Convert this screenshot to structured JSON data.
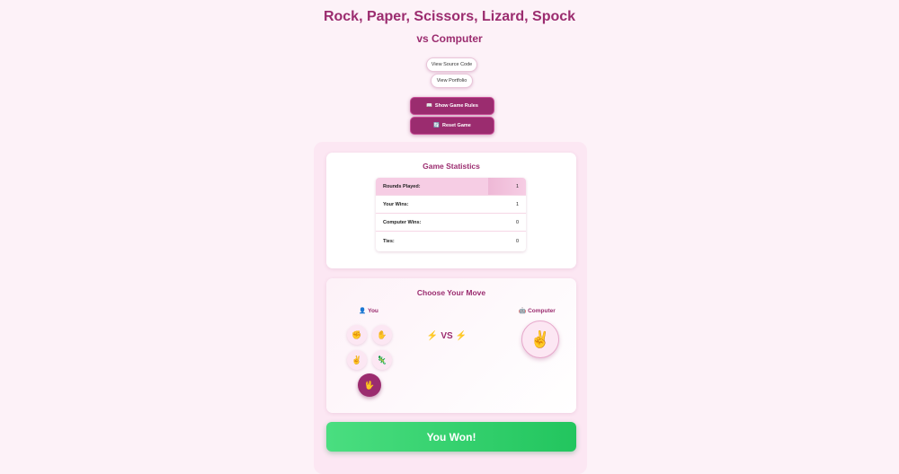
{
  "header": {
    "title": "Rock, Paper, Scissors, Lizard, Spock",
    "subtitle": "vs Computer"
  },
  "links": {
    "source_code": "View Source Code",
    "portfolio": "View Portfolio"
  },
  "actions": {
    "rules_icon": "📖",
    "rules_label": "Show Game Rules",
    "reset_icon": "🔄",
    "reset_label": "Reset Game"
  },
  "stats": {
    "title": "Game Statistics",
    "rows": [
      {
        "label": "Rounds Played:",
        "value": "1"
      },
      {
        "label": "Your Wins:",
        "value": "1"
      },
      {
        "label": "Computer Wins:",
        "value": "0"
      },
      {
        "label": "Ties:",
        "value": "0"
      }
    ]
  },
  "game": {
    "title": "Choose Your Move",
    "you_icon": "👤",
    "you_label": "You",
    "computer_icon": "🤖",
    "computer_label": "Computer",
    "vs_bolt": "⚡",
    "vs_text": "VS",
    "moves": [
      {
        "name": "rock",
        "glyph": "✊",
        "selected": false
      },
      {
        "name": "paper",
        "glyph": "✋",
        "selected": false
      },
      {
        "name": "scissors",
        "glyph": "✌",
        "selected": false
      },
      {
        "name": "lizard",
        "glyph": "🦎",
        "selected": false
      },
      {
        "name": "spock",
        "glyph": "🖖",
        "selected": true
      }
    ],
    "computer_choice": "✌"
  },
  "result": {
    "text": "You Won!"
  },
  "colors": {
    "accent": "#9b2c6f",
    "background": "#fdf2f8",
    "win": "#22c55e"
  }
}
